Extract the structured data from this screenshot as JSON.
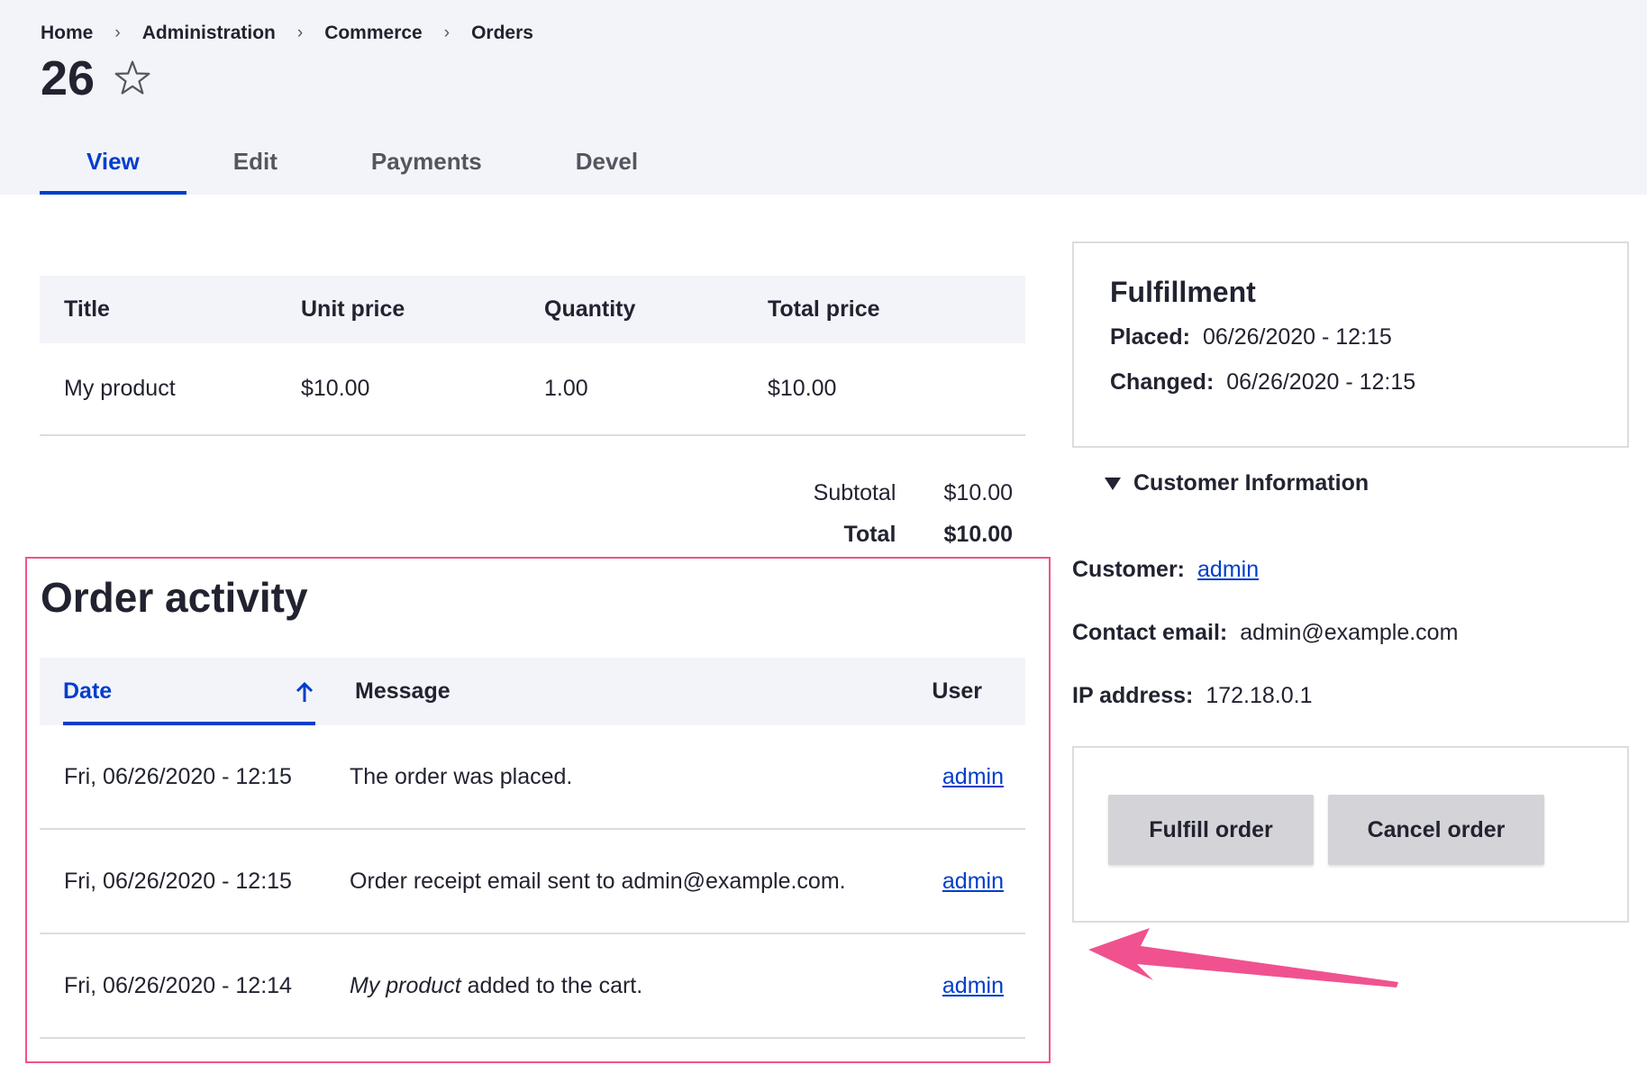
{
  "breadcrumb": {
    "items": [
      "Home",
      "Administration",
      "Commerce",
      "Orders"
    ],
    "separator": "›"
  },
  "page": {
    "title": "26"
  },
  "tabs": [
    {
      "label": "View",
      "active": true
    },
    {
      "label": "Edit",
      "active": false
    },
    {
      "label": "Payments",
      "active": false
    },
    {
      "label": "Devel",
      "active": false
    }
  ],
  "line_items": {
    "headers": [
      "Title",
      "Unit price",
      "Quantity",
      "Total price"
    ],
    "rows": [
      [
        "My product",
        "$10.00",
        "1.00",
        "$10.00"
      ]
    ]
  },
  "totals": {
    "subtotal_label": "Subtotal",
    "subtotal_value": "$10.00",
    "total_label": "Total",
    "total_value": "$10.00"
  },
  "activity": {
    "title": "Order activity",
    "headers": {
      "date": "Date",
      "message": "Message",
      "user": "User"
    },
    "rows": [
      {
        "date": "Fri, 06/26/2020 - 12:15",
        "message_em": "",
        "message": "The order was placed.",
        "user": "admin"
      },
      {
        "date": "Fri, 06/26/2020 - 12:15",
        "message_em": "",
        "message": "Order receipt email sent to admin@example.com.",
        "user": "admin"
      },
      {
        "date": "Fri, 06/26/2020 - 12:14",
        "message_em": "My product",
        "message": " added to the cart.",
        "user": "admin"
      }
    ]
  },
  "fulfillment": {
    "title": "Fulfillment",
    "placed_label": "Placed:",
    "placed_value": "06/26/2020 - 12:15",
    "changed_label": "Changed:",
    "changed_value": "06/26/2020 - 12:15"
  },
  "customer": {
    "toggle_label": "Customer Information",
    "customer_label": "Customer:",
    "customer_value": "admin",
    "email_label": "Contact email:",
    "email_value": "admin@example.com",
    "ip_label": "IP address:",
    "ip_value": "172.18.0.1"
  },
  "actions": {
    "fulfill_label": "Fulfill order",
    "cancel_label": "Cancel order"
  },
  "colors": {
    "accent": "#003ecc",
    "highlight": "#f0528f",
    "header_bg": "#f3f4f9"
  },
  "icons": [
    "star-icon",
    "arrow-up-icon",
    "triangle-down-icon",
    "pink-annotation-arrow-icon"
  ]
}
